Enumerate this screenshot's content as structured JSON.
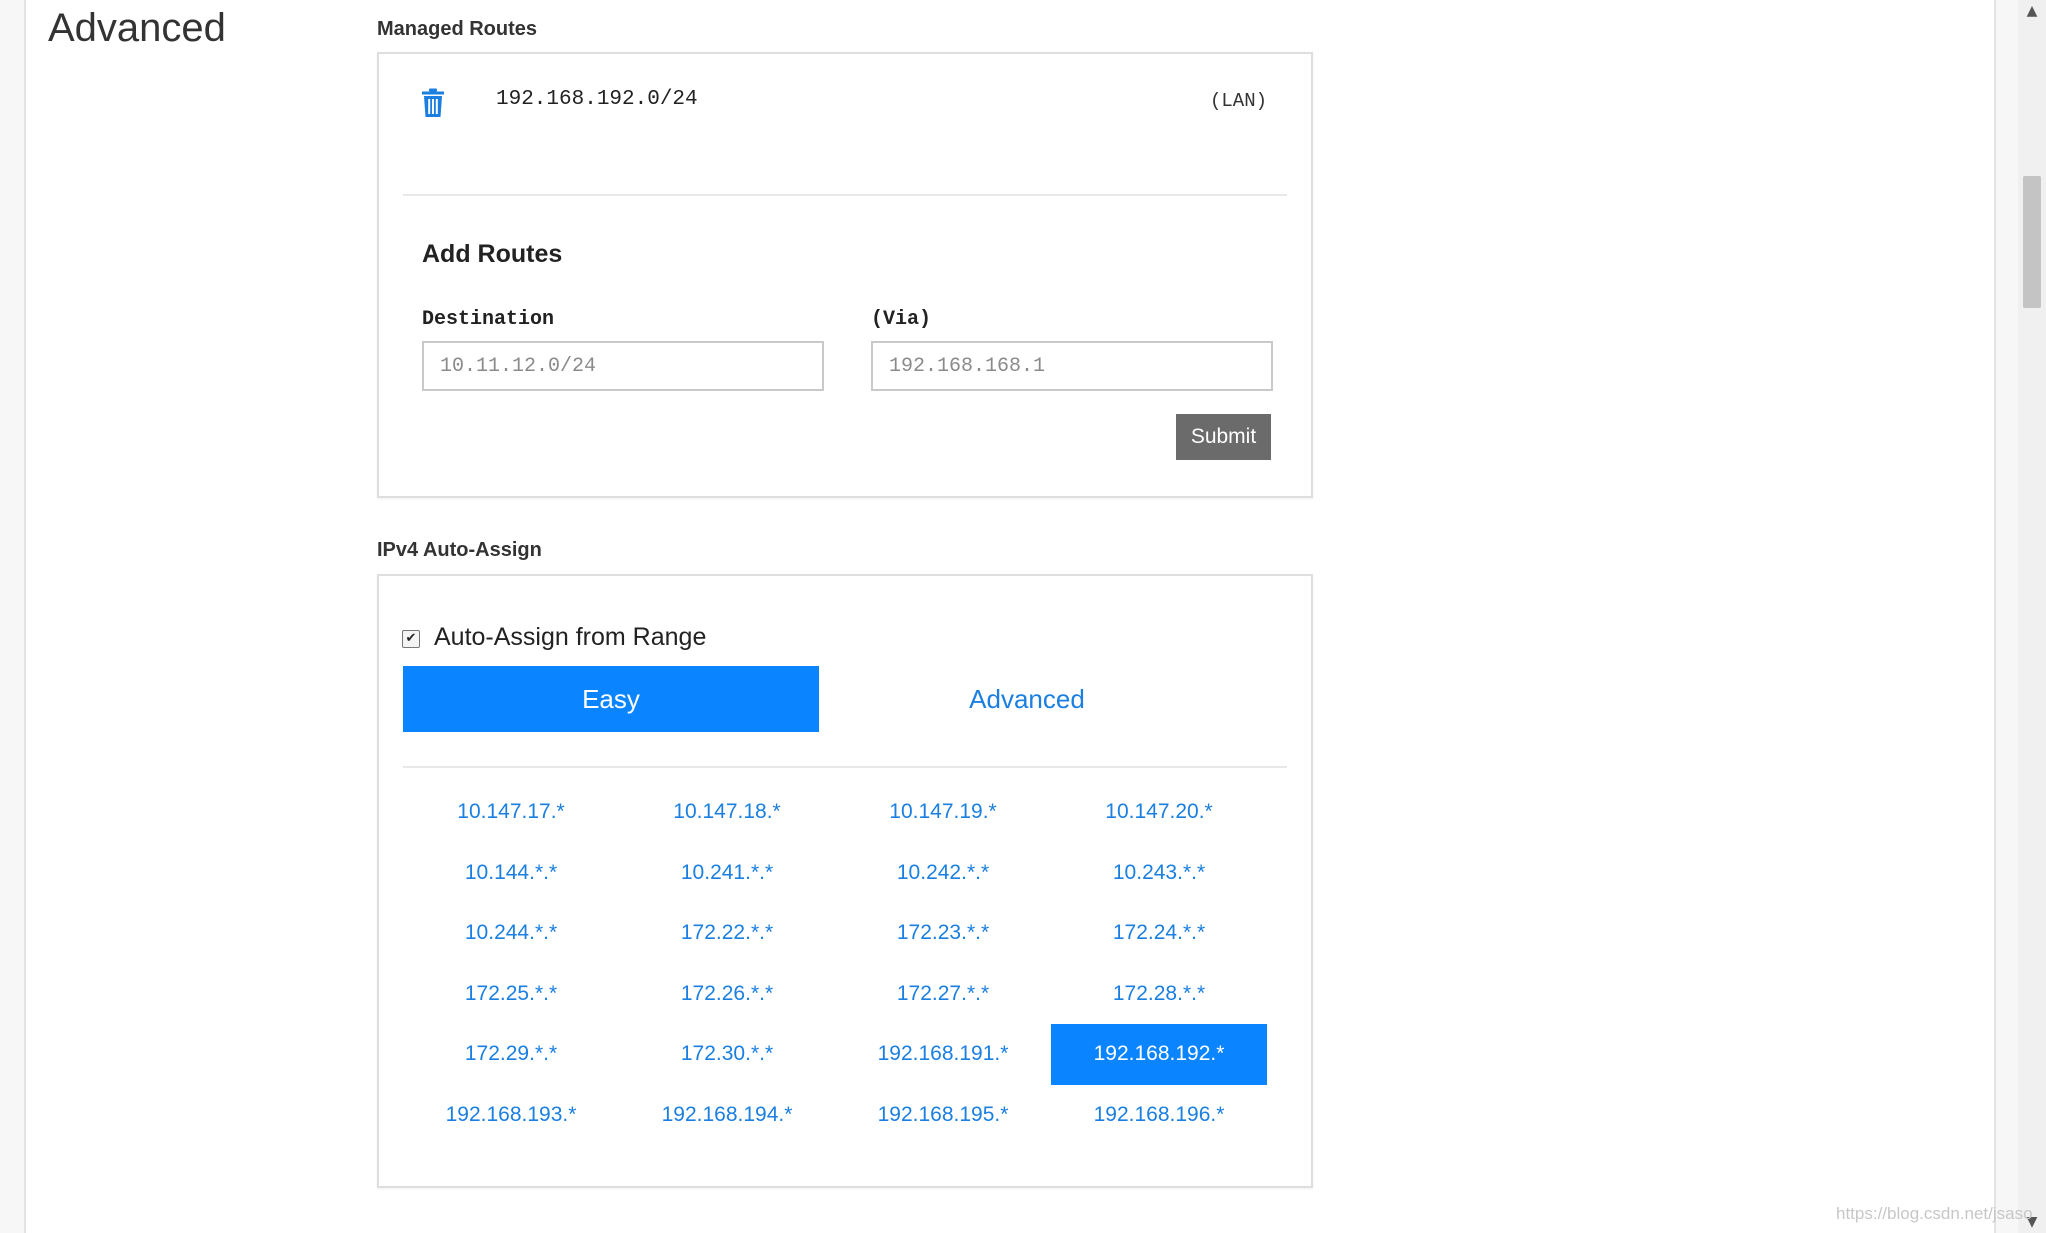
{
  "page": {
    "title": "Advanced"
  },
  "managed_routes": {
    "section_label": "Managed Routes",
    "routes": [
      {
        "destination": "192.168.192.0/24",
        "tag": "(LAN)",
        "delete_icon": "trash-icon"
      }
    ]
  },
  "add_routes": {
    "title": "Add Routes",
    "destination_label": "Destination",
    "destination_placeholder": "10.11.12.0/24",
    "via_label": "(Via)",
    "via_placeholder": "192.168.168.1",
    "submit_label": "Submit"
  },
  "ipv4_auto_assign": {
    "section_label": "IPv4 Auto-Assign",
    "auto_assign_label": "Auto-Assign from Range",
    "auto_assign_checked": true,
    "tabs": [
      {
        "label": "Easy",
        "active": true
      },
      {
        "label": "Advanced",
        "active": false
      }
    ],
    "ranges": [
      "10.147.17.*",
      "10.147.18.*",
      "10.147.19.*",
      "10.147.20.*",
      "10.144.*.*",
      "10.241.*.*",
      "10.242.*.*",
      "10.243.*.*",
      "10.244.*.*",
      "172.22.*.*",
      "172.23.*.*",
      "172.24.*.*",
      "172.25.*.*",
      "172.26.*.*",
      "172.27.*.*",
      "172.28.*.*",
      "172.29.*.*",
      "172.30.*.*",
      "192.168.191.*",
      "192.168.192.*",
      "192.168.193.*",
      "192.168.194.*",
      "192.168.195.*",
      "192.168.196.*"
    ],
    "selected_range": "192.168.192.*"
  },
  "watermark": "https://blog.csdn.net/jsaso",
  "colors": {
    "accent": "#0a84ff",
    "link": "#1a7fe0",
    "submit_bg": "#6b6b6b"
  }
}
